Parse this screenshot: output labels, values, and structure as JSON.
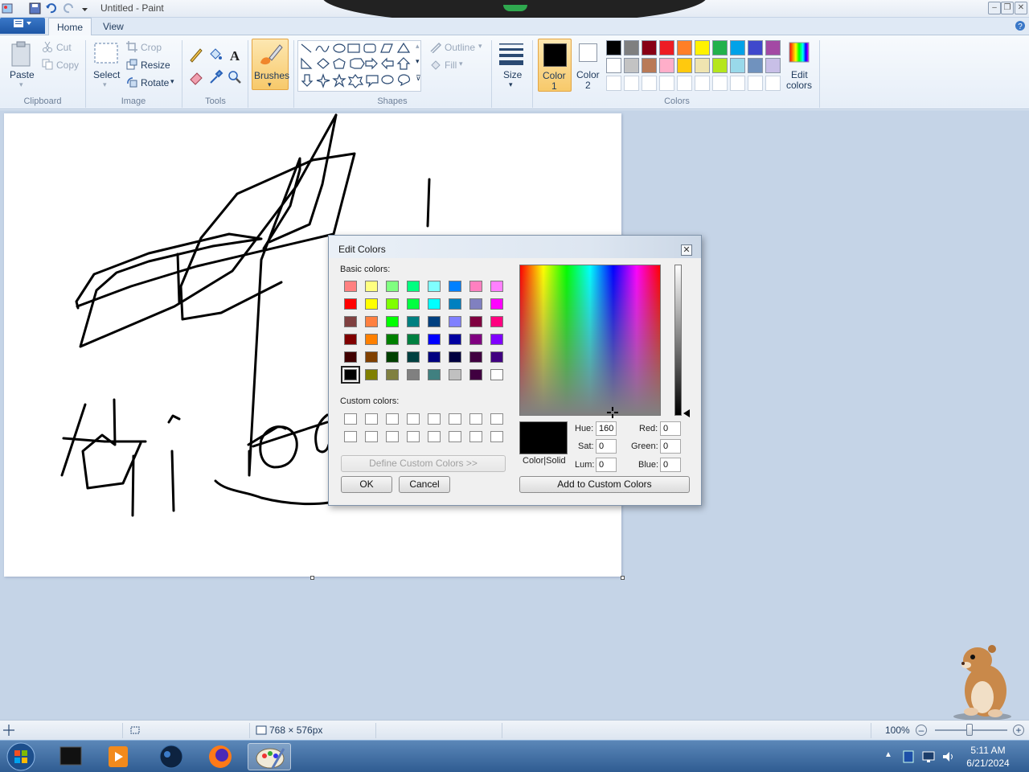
{
  "window": {
    "title": "Untitled - Paint"
  },
  "tabs": [
    {
      "label": "Home"
    },
    {
      "label": "View"
    }
  ],
  "ribbon": {
    "clipboard": {
      "paste": "Paste",
      "cut": "Cut",
      "copy": "Copy",
      "group": "Clipboard"
    },
    "image": {
      "select": "Select",
      "crop": "Crop",
      "resize": "Resize",
      "rotate": "Rotate",
      "group": "Image"
    },
    "tools": {
      "group": "Tools"
    },
    "brushes": {
      "label": "Brushes"
    },
    "shapes": {
      "outline": "Outline",
      "fill": "Fill",
      "group": "Shapes"
    },
    "size": {
      "label": "Size"
    },
    "colors": {
      "color1_line1": "Color",
      "color1_line2": "1",
      "color2_line1": "Color",
      "color2_line2": "2",
      "edit_line1": "Edit",
      "edit_line2": "colors",
      "group": "Colors",
      "palette_row1": [
        "#000000",
        "#7f7f7f",
        "#880015",
        "#ed1c24",
        "#ff7f27",
        "#fff200",
        "#22b14c",
        "#00a2e8",
        "#3f48cc",
        "#a349a4"
      ],
      "palette_row2": [
        "#ffffff",
        "#c3c3c3",
        "#b97a57",
        "#ffaec9",
        "#ffc90e",
        "#efe4b0",
        "#b5e61d",
        "#99d9ea",
        "#7092be",
        "#c8bfe7"
      ]
    }
  },
  "dialog": {
    "title": "Edit Colors",
    "basic_label": "Basic colors:",
    "custom_label": "Custom colors:",
    "define_custom": "Define Custom Colors >>",
    "ok": "OK",
    "cancel": "Cancel",
    "add_custom": "Add to Custom Colors",
    "color_solid": "Color|Solid",
    "hue_label": "Hue:",
    "hue": "160",
    "sat_label": "Sat:",
    "sat": "0",
    "lum_label": "Lum:",
    "lum": "0",
    "red_label": "Red:",
    "red": "0",
    "green_label": "Green:",
    "green": "0",
    "blue_label": "Blue:",
    "blue": "0",
    "basic_colors": [
      [
        "#ff8080",
        "#ffff80",
        "#80ff80",
        "#00ff80",
        "#80ffff",
        "#0080ff",
        "#ff80c0",
        "#ff80ff"
      ],
      [
        "#ff0000",
        "#ffff00",
        "#80ff00",
        "#00ff40",
        "#00ffff",
        "#0080c0",
        "#8080c0",
        "#ff00ff"
      ],
      [
        "#804040",
        "#ff8040",
        "#00ff00",
        "#008080",
        "#004080",
        "#8080ff",
        "#800040",
        "#ff0080"
      ],
      [
        "#800000",
        "#ff8000",
        "#008000",
        "#008040",
        "#0000ff",
        "#0000a0",
        "#800080",
        "#8000ff"
      ],
      [
        "#400000",
        "#804000",
        "#004000",
        "#004040",
        "#000080",
        "#000040",
        "#400040",
        "#400080"
      ],
      [
        "#000000",
        "#808000",
        "#808040",
        "#808080",
        "#408080",
        "#c0c0c0",
        "#400040",
        "#ffffff"
      ]
    ]
  },
  "statusbar": {
    "dimensions": "768 × 576px",
    "zoom": "100%"
  },
  "taskbar": {
    "time": "5:11 AM",
    "date": "6/21/2024"
  }
}
